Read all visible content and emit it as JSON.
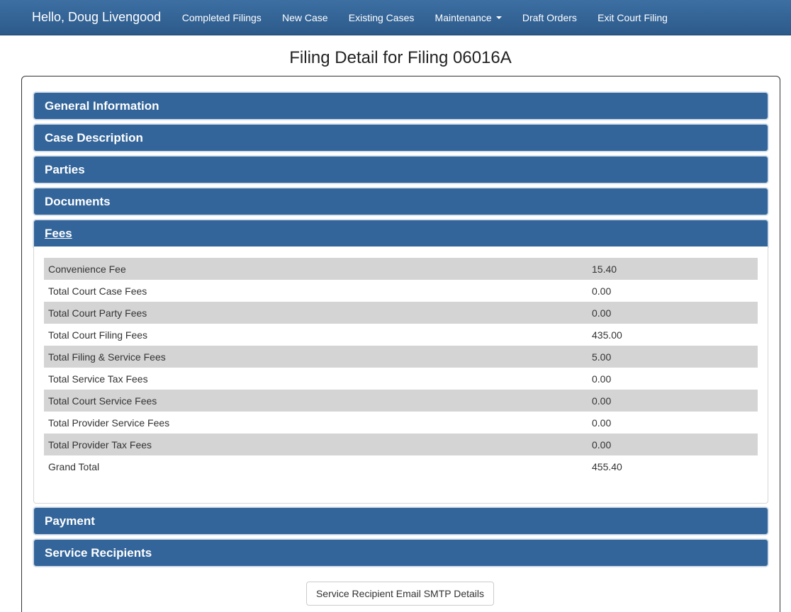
{
  "navbar": {
    "greeting": "Hello, Doug Livengood",
    "items": [
      {
        "label": "Completed Filings"
      },
      {
        "label": "New Case"
      },
      {
        "label": "Existing Cases"
      },
      {
        "label": "Maintenance"
      },
      {
        "label": "Draft Orders"
      },
      {
        "label": "Exit Court Filing"
      }
    ]
  },
  "page": {
    "title": "Filing Detail for Filing 06016A"
  },
  "sections": {
    "general_information": "General Information",
    "case_description": "Case Description",
    "parties": "Parties",
    "documents": "Documents",
    "fees": "Fees",
    "payment": "Payment",
    "service_recipients": "Service Recipients"
  },
  "fees": {
    "rows": [
      {
        "label": "Convenience Fee",
        "amount": "15.40"
      },
      {
        "label": "Total Court Case Fees",
        "amount": "0.00"
      },
      {
        "label": "Total Court Party Fees",
        "amount": "0.00"
      },
      {
        "label": "Total Court Filing Fees",
        "amount": "435.00"
      },
      {
        "label": "Total Filing & Service Fees",
        "amount": "5.00"
      },
      {
        "label": "Total Service Tax Fees",
        "amount": "0.00"
      },
      {
        "label": "Total Court Service Fees",
        "amount": "0.00"
      },
      {
        "label": "Total Provider Service Fees",
        "amount": "0.00"
      },
      {
        "label": "Total Provider Tax Fees",
        "amount": "0.00"
      },
      {
        "label": "Grand Total",
        "amount": "455.40"
      }
    ]
  },
  "actions": {
    "smtp_details_label": "Service Recipient Email SMTP Details"
  },
  "colors": {
    "navbar": "#2c5a8a",
    "section_header": "#33659a",
    "row_stripe": "#d4d4d4"
  }
}
